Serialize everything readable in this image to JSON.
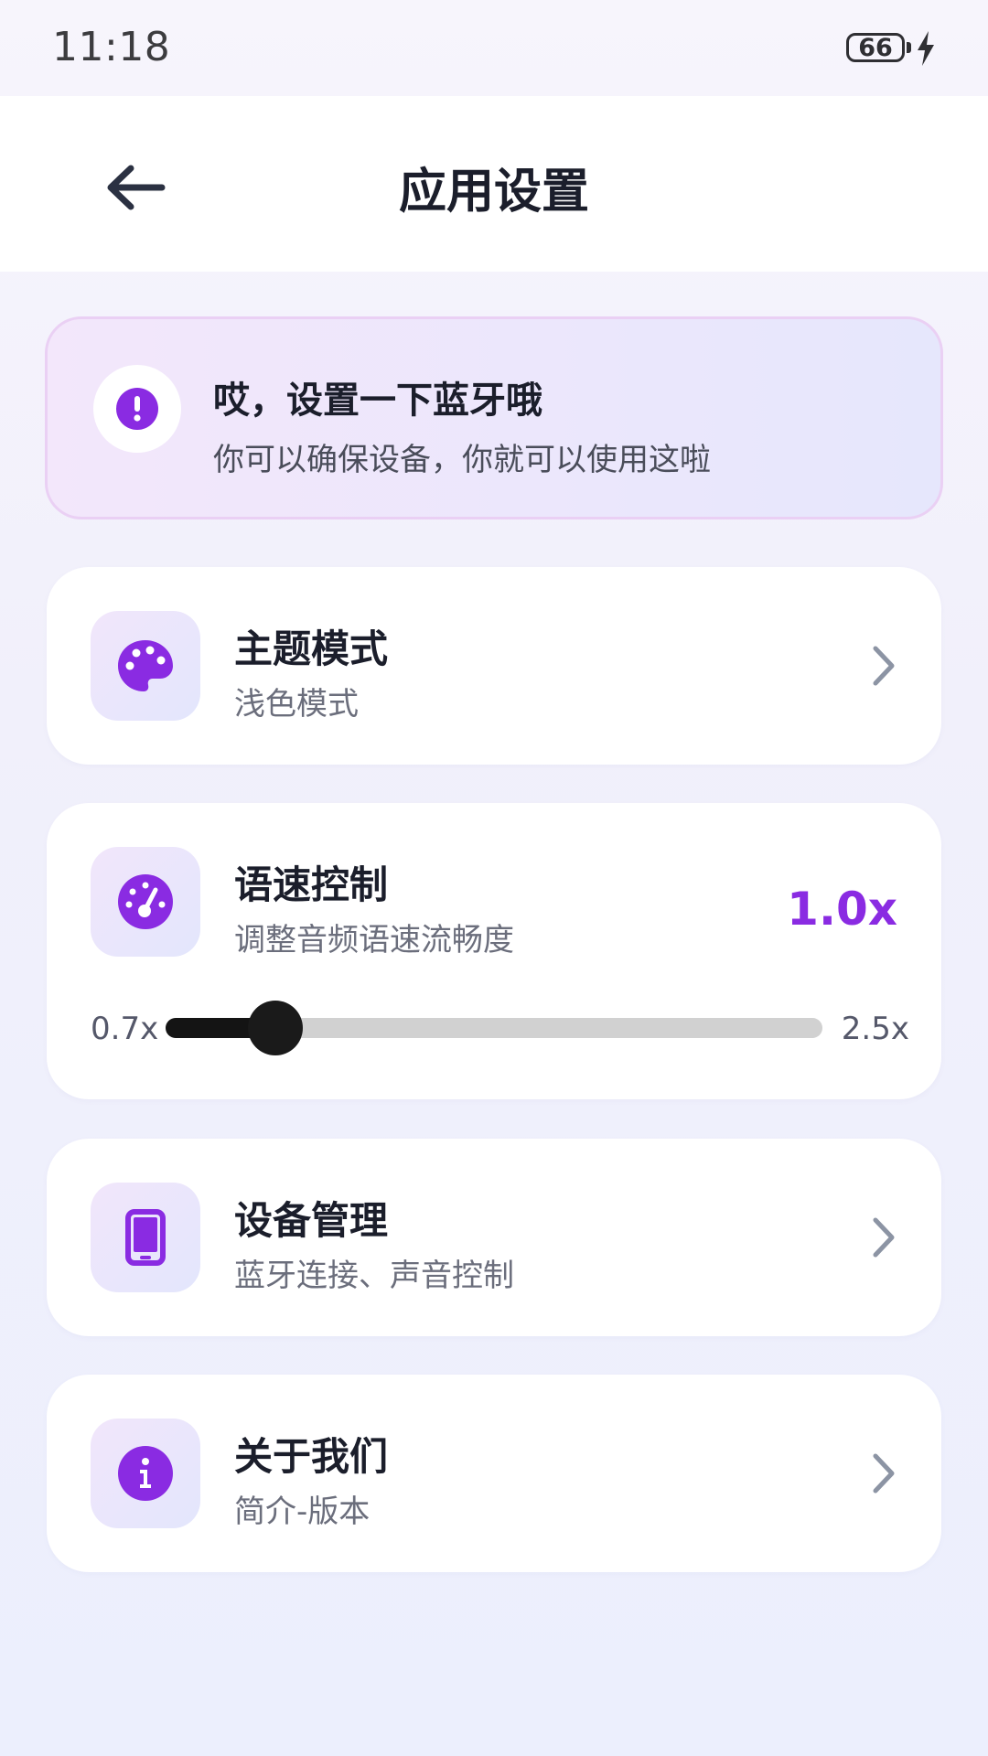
{
  "status_bar": {
    "time": "11:18",
    "battery_level": "66"
  },
  "header": {
    "title": "应用设置"
  },
  "notice": {
    "title": "哎，设置一下蓝牙哦",
    "text": "你可以确保设备，你就可以使用这啦",
    "icon": "exclamation-icon"
  },
  "settings": {
    "theme": {
      "title": "主题模式",
      "subtitle": "浅色模式",
      "icon": "palette-icon"
    },
    "speed": {
      "title": "语速控制",
      "subtitle": "调整音频语速流畅度",
      "value_label": "1.0x",
      "min_label": "0.7x",
      "max_label": "2.5x",
      "value": 1.0,
      "min": 0.7,
      "max": 2.5,
      "icon": "speedometer-icon"
    },
    "device": {
      "title": "设备管理",
      "subtitle": "蓝牙连接、声音控制",
      "icon": "phone-icon"
    },
    "about": {
      "title": "关于我们",
      "subtitle": "简介-版本",
      "icon": "info-icon"
    }
  },
  "colors": {
    "accent": "#8a2be2",
    "title_text": "#1b1e2b",
    "sub_text": "#6b6e7c",
    "chevron": "#8c94a4",
    "slider_fill": "#141414",
    "slider_track": "#d1d1d1"
  }
}
